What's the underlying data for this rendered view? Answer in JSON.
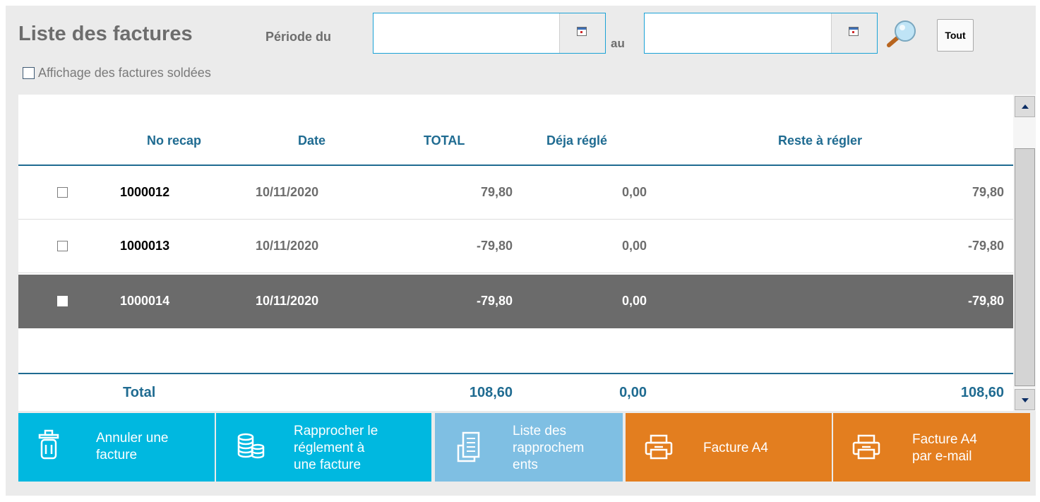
{
  "header": {
    "title": "Liste des factures",
    "period_from_label": "Période du",
    "period_to_label": "au",
    "period_from_value": "",
    "period_to_value": "",
    "tout_label": "Tout"
  },
  "options": {
    "show_paid_label": "Affichage des factures soldées",
    "show_paid_checked": false
  },
  "table": {
    "columns": [
      "No recap",
      "Date",
      "TOTAL",
      "Déja réglé",
      "Reste à régler"
    ],
    "rows": [
      {
        "no": "1000012",
        "date": "10/11/2020",
        "total": "79,80",
        "regle": "0,00",
        "reste": "79,80",
        "selected": false
      },
      {
        "no": "1000013",
        "date": "10/11/2020",
        "total": "-79,80",
        "regle": "0,00",
        "reste": "-79,80",
        "selected": false
      },
      {
        "no": "1000014",
        "date": "10/11/2020",
        "total": "-79,80",
        "regle": "0,00",
        "reste": "-79,80",
        "selected": true
      }
    ],
    "footer": {
      "label": "Total",
      "total": "108,60",
      "regle": "0,00",
      "reste": "108,60"
    }
  },
  "actions": [
    {
      "id": "annuler",
      "label_lines": [
        "Annuler une",
        "facture"
      ],
      "icon": "trash-icon"
    },
    {
      "id": "rapprocher",
      "label_lines": [
        "Rapprocher le",
        "réglement à",
        "une facture"
      ],
      "icon": "coins-icon"
    },
    {
      "id": "liste-rapprochements",
      "label_lines": [
        "Liste des",
        "rapprochem",
        "ents"
      ],
      "icon": "document-list-icon"
    },
    {
      "id": "facture-a4",
      "label_lines": [
        "Facture A4"
      ],
      "icon": "printer-icon"
    },
    {
      "id": "facture-a4-email",
      "label_lines": [
        "Facture A4",
        "par e-mail"
      ],
      "icon": "printer-icon"
    }
  ],
  "colors": {
    "accent_blue": "#1f6b91",
    "button_cyan": "#00b8e0",
    "button_light_blue": "#7fbfe3",
    "button_orange": "#e37e1f",
    "selected_row": "#6b6b6b"
  }
}
